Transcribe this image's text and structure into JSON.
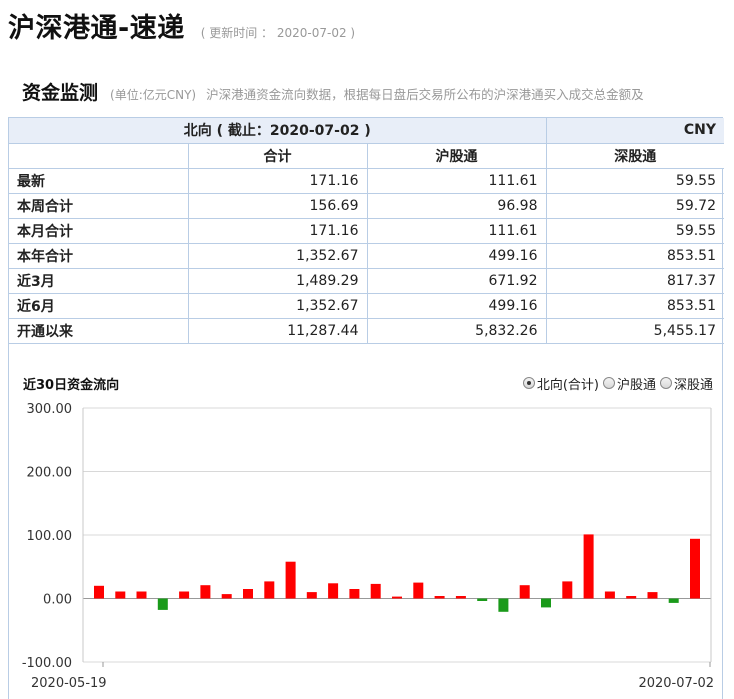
{
  "page": {
    "title": "沪深港通-速递",
    "update_label": "( 更新时间 ： ",
    "update_date": "2020-07-02",
    "update_close": " )"
  },
  "section": {
    "title": "资金监测",
    "unit": "(单位:亿元CNY)",
    "desc": "沪深港通资金流向数据，根据每日盘后交易所公布的沪深港通买入成交总金额及"
  },
  "table": {
    "header": "北向 ( 截止：2020-07-02 )",
    "currency": "CNY",
    "columns": [
      "合计",
      "沪股通",
      "深股通"
    ],
    "rows": [
      {
        "label": "最新",
        "values": [
          "171.16",
          "111.61",
          "59.55"
        ]
      },
      {
        "label": "本周合计",
        "values": [
          "156.69",
          "96.98",
          "59.72"
        ]
      },
      {
        "label": "本月合计",
        "values": [
          "171.16",
          "111.61",
          "59.55"
        ]
      },
      {
        "label": "本年合计",
        "values": [
          "1,352.67",
          "499.16",
          "853.51"
        ]
      },
      {
        "label": "近3月",
        "values": [
          "1,489.29",
          "671.92",
          "817.37"
        ]
      },
      {
        "label": "近6月",
        "values": [
          "1,352.67",
          "499.16",
          "853.51"
        ]
      },
      {
        "label": "开通以来",
        "values": [
          "11,287.44",
          "5,832.26",
          "5,455.17"
        ]
      }
    ]
  },
  "chart_header": {
    "title": "近30日资金流向",
    "options": [
      {
        "label": "北向(合计)",
        "selected": true
      },
      {
        "label": "沪股通",
        "selected": false
      },
      {
        "label": "深股通",
        "selected": false
      }
    ]
  },
  "chart_data": {
    "type": "bar",
    "ylim": [
      -100,
      300
    ],
    "yticks": [
      "300.00",
      "200.00",
      "100.00",
      "0.00",
      "-100.00"
    ],
    "ytick_values": [
      300,
      200,
      100,
      0,
      -100
    ],
    "x_start_label": "2020-05-19",
    "x_end_label": "2020-07-02",
    "positive_color": "#ff0000",
    "negative_color": "#1a9a1a",
    "values": [
      20,
      11,
      11,
      -18,
      11,
      21,
      7,
      15,
      27,
      58,
      10,
      24,
      15,
      23,
      3,
      25,
      4,
      4,
      -4,
      -21,
      21,
      -14,
      27,
      101,
      11,
      4,
      10,
      -7,
      94
    ]
  }
}
